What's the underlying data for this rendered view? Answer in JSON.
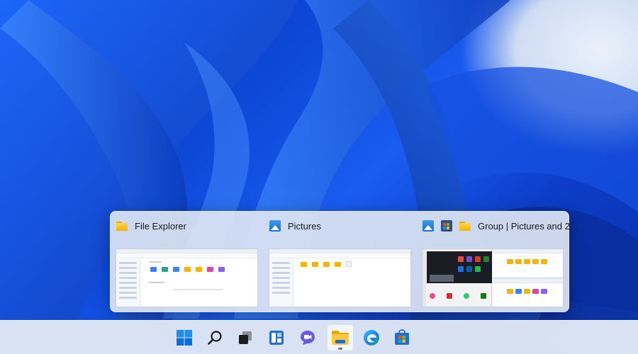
{
  "flyout": {
    "cards": [
      {
        "title": "File Explorer",
        "icons": [
          "folder-icon"
        ]
      },
      {
        "title": "Pictures",
        "icons": [
          "pictures-icon"
        ]
      },
      {
        "title": "Group | Pictures and 2...",
        "icons": [
          "pictures-icon",
          "store-icon",
          "folder-icon"
        ]
      }
    ]
  },
  "taskbar": {
    "items": [
      {
        "name": "start",
        "icon": "windows-logo-icon"
      },
      {
        "name": "search",
        "icon": "search-icon"
      },
      {
        "name": "task-view",
        "icon": "task-view-icon"
      },
      {
        "name": "widgets",
        "icon": "widgets-icon"
      },
      {
        "name": "chat",
        "icon": "chat-icon"
      },
      {
        "name": "file-explorer",
        "icon": "folder-icon",
        "active": true
      },
      {
        "name": "edge",
        "icon": "edge-icon"
      },
      {
        "name": "store",
        "icon": "store-icon"
      }
    ]
  },
  "colors": {
    "accent": "#0067c0",
    "wallpaper_blue": "#0d48d8",
    "folder_yellow": "#f4b400"
  }
}
